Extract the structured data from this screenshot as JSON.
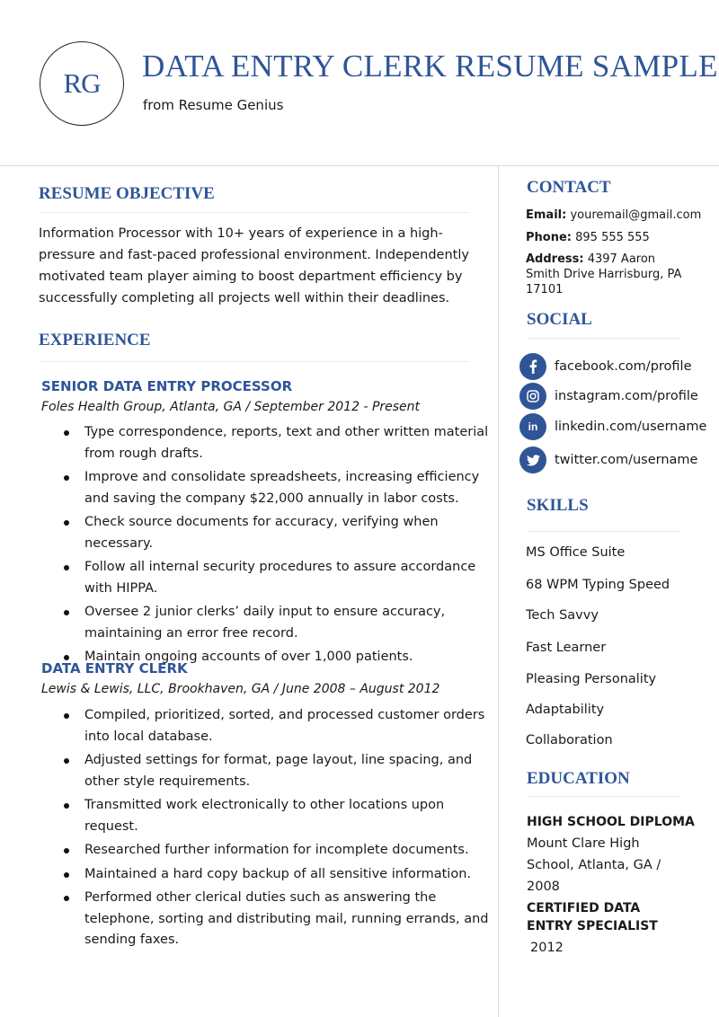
{
  "header": {
    "monogram": "RG",
    "title": "DATA ENTRY CLERK RESUME SAMPLE",
    "subtitle": "from Resume Genius"
  },
  "objective": {
    "heading": "RESUME OBJECTIVE",
    "text": "Information Processor with 10+ years of experience in a high-pressure and fast-paced professional environment. Independently motivated team player aiming to boost department efficiency by successfully completing all projects well within their deadlines."
  },
  "experience": {
    "heading": "EXPERIENCE",
    "jobs": [
      {
        "title": "SENIOR DATA ENTRY PROCESSOR",
        "meta": "Foles Health Group, Atlanta, GA  /  September 2012 - Present",
        "bullets": [
          "Type correspondence, reports, text and other written material from rough drafts.",
          "Improve and consolidate spreadsheets, increasing efficiency and saving the company $22,000 annually in labor costs.",
          "Check source documents for accuracy, verifying when necessary.",
          "Follow all internal security procedures to assure accordance with HIPPA.",
          "Oversee 2 junior clerks’ daily input to ensure accuracy, maintaining an error free record.",
          "Maintain ongoing accounts of over 1,000 patients."
        ]
      },
      {
        "title": "DATA ENTRY CLERK",
        "meta": "Lewis & Lewis, LLC, Brookhaven, GA  /  June 2008 – August 2012",
        "bullets": [
          "Compiled, prioritized, sorted, and processed customer orders into local database.",
          "Adjusted settings for format, page layout, line spacing, and other style requirements.",
          "Transmitted work electronically to other locations upon request.",
          "Researched further information for incomplete documents.",
          "Maintained a hard copy backup of all sensitive information.",
          "Performed other clerical duties such as answering the telephone, sorting and distributing mail, running errands, and sending faxes."
        ]
      }
    ]
  },
  "contact": {
    "heading": "CONTACT",
    "email_label": "Email:",
    "email": "youremail@gmail.com",
    "phone_label": "Phone:",
    "phone": "895 555 555",
    "address_label": "Address:",
    "address": "4397 Aaron Smith Drive Harrisburg, PA 17101"
  },
  "social": {
    "heading": "SOCIAL",
    "items": [
      {
        "icon": "facebook-icon",
        "glyph": "f",
        "label": "facebook.com/profile"
      },
      {
        "icon": "instagram-icon",
        "glyph": "◎",
        "label": "instagram.com/profile"
      },
      {
        "icon": "linkedin-icon",
        "glyph": "in",
        "label": "linkedin.com/username"
      },
      {
        "icon": "twitter-icon",
        "glyph": "🐦",
        "label": "twitter.com/username"
      }
    ]
  },
  "skills": {
    "heading": "SKILLS",
    "items": [
      "MS Office Suite",
      "68 WPM Typing Speed",
      "Tech Savvy",
      "Fast Learner",
      "Pleasing Personality",
      "Adaptability",
      "Collaboration"
    ]
  },
  "education": {
    "heading": "EDUCATION",
    "items": [
      {
        "title": "HIGH SCHOOL DIPLOMA",
        "detail": "Mount Clare High School, Atlanta, GA / 2008"
      },
      {
        "title": "CERTIFIED DATA ENTRY SPECIALIST",
        "detail": "2012"
      }
    ]
  },
  "colors": {
    "accent": "#2f5597",
    "text": "#1a1a1a",
    "divider": "#dcdcdc"
  }
}
